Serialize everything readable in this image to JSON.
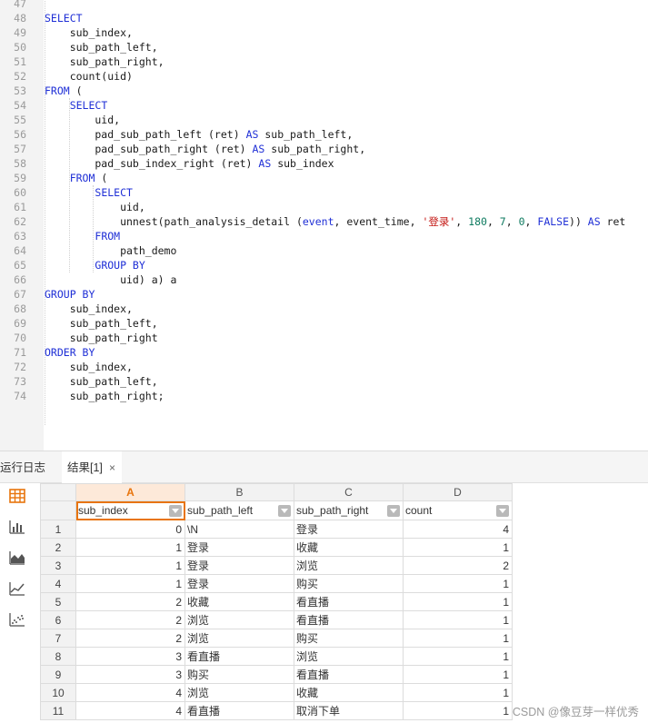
{
  "editor": {
    "lines": [
      {
        "n": "47",
        "tokens": []
      },
      {
        "n": "48",
        "tokens": [
          {
            "t": "SELECT",
            "c": "kw"
          }
        ]
      },
      {
        "n": "49",
        "tokens": [
          {
            "t": "    sub_index,",
            "c": ""
          }
        ]
      },
      {
        "n": "50",
        "tokens": [
          {
            "t": "    sub_path_left,",
            "c": ""
          }
        ]
      },
      {
        "n": "51",
        "tokens": [
          {
            "t": "    sub_path_right,",
            "c": ""
          }
        ]
      },
      {
        "n": "52",
        "tokens": [
          {
            "t": "    count(uid)",
            "c": ""
          }
        ]
      },
      {
        "n": "53",
        "tokens": [
          {
            "t": "FROM",
            "c": "kw"
          },
          {
            "t": " (",
            "c": ""
          }
        ]
      },
      {
        "n": "54",
        "tokens": [
          {
            "t": "    ",
            "c": ""
          },
          {
            "t": "SELECT",
            "c": "kw"
          }
        ]
      },
      {
        "n": "55",
        "tokens": [
          {
            "t": "        uid,",
            "c": ""
          }
        ]
      },
      {
        "n": "56",
        "tokens": [
          {
            "t": "        pad_sub_path_left (ret) ",
            "c": ""
          },
          {
            "t": "AS",
            "c": "kw"
          },
          {
            "t": " sub_path_left,",
            "c": ""
          }
        ]
      },
      {
        "n": "57",
        "tokens": [
          {
            "t": "        pad_sub_path_right (ret) ",
            "c": ""
          },
          {
            "t": "AS",
            "c": "kw"
          },
          {
            "t": " sub_path_right,",
            "c": ""
          }
        ]
      },
      {
        "n": "58",
        "tokens": [
          {
            "t": "        pad_sub_index_right (ret) ",
            "c": ""
          },
          {
            "t": "AS",
            "c": "kw"
          },
          {
            "t": " sub_index",
            "c": ""
          }
        ]
      },
      {
        "n": "59",
        "tokens": [
          {
            "t": "    ",
            "c": ""
          },
          {
            "t": "FROM",
            "c": "kw"
          },
          {
            "t": " (",
            "c": ""
          }
        ]
      },
      {
        "n": "60",
        "tokens": [
          {
            "t": "        ",
            "c": ""
          },
          {
            "t": "SELECT",
            "c": "kw"
          }
        ]
      },
      {
        "n": "61",
        "tokens": [
          {
            "t": "            uid,",
            "c": ""
          }
        ]
      },
      {
        "n": "62",
        "tokens": [
          {
            "t": "            unnest(path_analysis_detail (",
            "c": ""
          },
          {
            "t": "event",
            "c": "kw"
          },
          {
            "t": ", event_time, ",
            "c": ""
          },
          {
            "t": "'登录'",
            "c": "str"
          },
          {
            "t": ", ",
            "c": ""
          },
          {
            "t": "180",
            "c": "num"
          },
          {
            "t": ", ",
            "c": ""
          },
          {
            "t": "7",
            "c": "num"
          },
          {
            "t": ", ",
            "c": ""
          },
          {
            "t": "0",
            "c": "num"
          },
          {
            "t": ", ",
            "c": ""
          },
          {
            "t": "FALSE",
            "c": "kw"
          },
          {
            "t": ")) ",
            "c": ""
          },
          {
            "t": "AS",
            "c": "kw"
          },
          {
            "t": " ret",
            "c": ""
          }
        ]
      },
      {
        "n": "63",
        "tokens": [
          {
            "t": "        ",
            "c": ""
          },
          {
            "t": "FROM",
            "c": "kw"
          }
        ]
      },
      {
        "n": "64",
        "tokens": [
          {
            "t": "            path_demo",
            "c": ""
          }
        ]
      },
      {
        "n": "65",
        "tokens": [
          {
            "t": "        ",
            "c": ""
          },
          {
            "t": "GROUP BY",
            "c": "kw"
          }
        ]
      },
      {
        "n": "66",
        "tokens": [
          {
            "t": "            uid) a) a",
            "c": ""
          }
        ]
      },
      {
        "n": "67",
        "tokens": [
          {
            "t": "GROUP BY",
            "c": "kw"
          }
        ]
      },
      {
        "n": "68",
        "tokens": [
          {
            "t": "    sub_index,",
            "c": ""
          }
        ]
      },
      {
        "n": "69",
        "tokens": [
          {
            "t": "    sub_path_left,",
            "c": ""
          }
        ]
      },
      {
        "n": "70",
        "tokens": [
          {
            "t": "    sub_path_right",
            "c": ""
          }
        ]
      },
      {
        "n": "71",
        "tokens": [
          {
            "t": "ORDER BY",
            "c": "kw"
          }
        ]
      },
      {
        "n": "72",
        "tokens": [
          {
            "t": "    sub_index,",
            "c": ""
          }
        ]
      },
      {
        "n": "73",
        "tokens": [
          {
            "t": "    sub_path_left,",
            "c": ""
          }
        ]
      },
      {
        "n": "74",
        "tokens": [
          {
            "t": "    sub_path_right;",
            "c": ""
          }
        ]
      }
    ]
  },
  "tabs": {
    "log_label": "运行日志",
    "result_label": "结果[1]",
    "close_glyph": "×"
  },
  "toolbar": {
    "icons": [
      "table-view-icon",
      "bar-chart-icon",
      "area-chart-icon",
      "line-chart-icon",
      "scatter-chart-icon"
    ],
    "active_color": "#e8740c",
    "icon_color": "#555555"
  },
  "grid": {
    "column_letters": [
      "A",
      "B",
      "C",
      "D"
    ],
    "fields": [
      "sub_index",
      "sub_path_left",
      "sub_path_right",
      "count"
    ],
    "rows": [
      [
        "1",
        "0",
        "\\N",
        "登录",
        "4"
      ],
      [
        "2",
        "1",
        "登录",
        "收藏",
        "1"
      ],
      [
        "3",
        "1",
        "登录",
        "浏览",
        "2"
      ],
      [
        "4",
        "1",
        "登录",
        "购买",
        "1"
      ],
      [
        "5",
        "2",
        "收藏",
        "看直播",
        "1"
      ],
      [
        "6",
        "2",
        "浏览",
        "看直播",
        "1"
      ],
      [
        "7",
        "2",
        "浏览",
        "购买",
        "1"
      ],
      [
        "8",
        "3",
        "看直播",
        "浏览",
        "1"
      ],
      [
        "9",
        "3",
        "购买",
        "看直播",
        "1"
      ],
      [
        "10",
        "4",
        "浏览",
        "收藏",
        "1"
      ],
      [
        "11",
        "4",
        "看直播",
        "取消下单",
        "1"
      ]
    ]
  },
  "watermark": "CSDN @像豆芽一样优秀",
  "colors": {
    "keyword": "#1f2fd6",
    "string": "#c41a16",
    "number": "#0d7a5f",
    "selection": "#e8740c"
  }
}
